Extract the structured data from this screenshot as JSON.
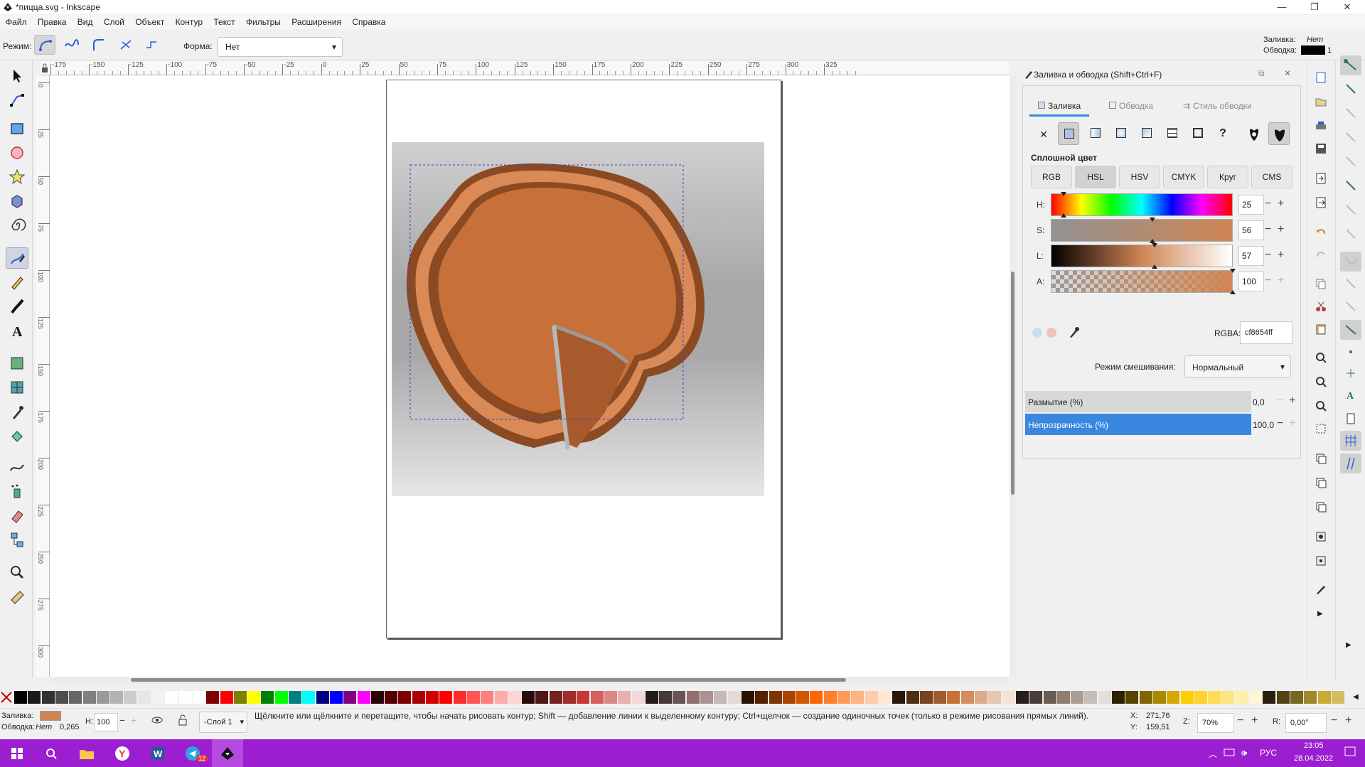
{
  "window": {
    "title": "*пицца.svg - Inkscape",
    "minimize": "—",
    "maximize": "❐",
    "close": "✕"
  },
  "menu": [
    "Файл",
    "Правка",
    "Вид",
    "Слой",
    "Объект",
    "Контур",
    "Текст",
    "Фильтры",
    "Расширения",
    "Справка"
  ],
  "tool_controls": {
    "mode_label": "Режим:",
    "shape_label": "Форма:",
    "shape_value": "Нет"
  },
  "style_indicator": {
    "fill_label": "Заливка:",
    "fill_value": "Нет",
    "stroke_label": "Обводка:",
    "stroke_width": "1"
  },
  "ruler": {
    "h_labels": [
      "-175",
      "-150",
      "-125",
      "-100",
      "-75",
      "-50",
      "-25",
      "0",
      "25",
      "50",
      "75",
      "100",
      "125",
      "150",
      "175",
      "200",
      "225",
      "250",
      "275",
      "300",
      "325"
    ],
    "v_labels": [
      "0",
      "25",
      "50",
      "75",
      "100",
      "125",
      "150",
      "175",
      "200",
      "225",
      "250",
      "275",
      "300"
    ]
  },
  "panel": {
    "title": "Заливка и обводка (Shift+Ctrl+F)",
    "tabs": [
      "Заливка",
      "Обводка",
      "Стиль обводки"
    ],
    "flat_label": "Сплошной цвет",
    "color_modes": [
      "RGB",
      "HSL",
      "HSV",
      "CMYK",
      "Круг",
      "CMS"
    ],
    "sliders": [
      {
        "label": "H:",
        "value": "25",
        "pos": 0.07
      },
      {
        "label": "S:",
        "value": "56",
        "pos": 0.56
      },
      {
        "label": "L:",
        "value": "57",
        "pos": 0.57
      },
      {
        "label": "A:",
        "value": "100",
        "pos": 1.0
      }
    ],
    "rgba_label": "RGBA:",
    "rgba_value": "cf8654ff",
    "blend_label": "Режим смешивания:",
    "blend_value": "Нормальный",
    "blur_label": "Размытие (%)",
    "blur_value": "0,0",
    "opacity_label": "Непрозрачность (%)",
    "opacity_value": "100,0",
    "fill_color": "#cf8654"
  },
  "status": {
    "fill_label": "Заливка:",
    "stroke_label": "Обводка:",
    "stroke_value": "Нет",
    "stroke_width": "0,265",
    "h_label": "H:",
    "h_value": "100",
    "layer": "-Слой 1",
    "message": "Щёлкните или щёлкните и перетащите, чтобы начать рисовать контур; Shift — добавление линии к выделенному контуру; Ctrl+щелчок — создание одиночных точек (только в режиме рисования прямых линий).",
    "x_label": "X:",
    "x_value": "271,76",
    "y_label": "Y:",
    "y_value": "159,51",
    "zoom_label": "Z:",
    "zoom_value": "70%",
    "rot_label": "R:",
    "rot_value": "0,00°"
  },
  "taskbar": {
    "lang": "РУС",
    "time": "23:05",
    "date": "28.04.2022",
    "badge": "12"
  },
  "palette": [
    "#000000",
    "#1a1a1a",
    "#333333",
    "#4d4d4d",
    "#666666",
    "#808080",
    "#999999",
    "#b3b3b3",
    "#cccccc",
    "#e6e6e6",
    "#f2f2f2",
    "#ffffff",
    "#ffffff",
    "#ffffff",
    "#800000",
    "#ff0000",
    "#808000",
    "#ffff00",
    "#008000",
    "#00ff00",
    "#008080",
    "#00ffff",
    "#000080",
    "#0000ff",
    "#800080",
    "#ff00ff",
    "#2b0000",
    "#550000",
    "#800000",
    "#aa0000",
    "#d40000",
    "#ff0000",
    "#ff2a2a",
    "#ff5555",
    "#ff8080",
    "#ffaaaa",
    "#ffd5d5",
    "#280b0b",
    "#501616",
    "#782121",
    "#a02c2c",
    "#c83737",
    "#d35f5f",
    "#de8787",
    "#e9afaf",
    "#f4d7d7",
    "#241c1c",
    "#483737",
    "#6c5353",
    "#916f6f",
    "#ac9393",
    "#c8b7b7",
    "#e3dbdb",
    "#2b1100",
    "#552200",
    "#803300",
    "#aa4400",
    "#d45500",
    "#ff6600",
    "#ff7f2a",
    "#ff9955",
    "#ffb380",
    "#ffccaa",
    "#ffe6d5",
    "#28170b",
    "#502d16",
    "#784421",
    "#a05a2c",
    "#c87137",
    "#d38d5f",
    "#deaa87",
    "#e9c6af",
    "#f4e3d7",
    "#241f1c",
    "#483e37",
    "#6c5d53",
    "#917c6f",
    "#ac9d93",
    "#c8beb7",
    "#e3dedb",
    "#2b2200",
    "#554400",
    "#806600",
    "#aa8800",
    "#d4aa00",
    "#ffcc00",
    "#ffd42a",
    "#ffdd55",
    "#ffe680",
    "#ffeeaa",
    "#fff6d5",
    "#28220b",
    "#504416",
    "#786721",
    "#a0892c",
    "#c8ab37",
    "#d4bd5f"
  ]
}
